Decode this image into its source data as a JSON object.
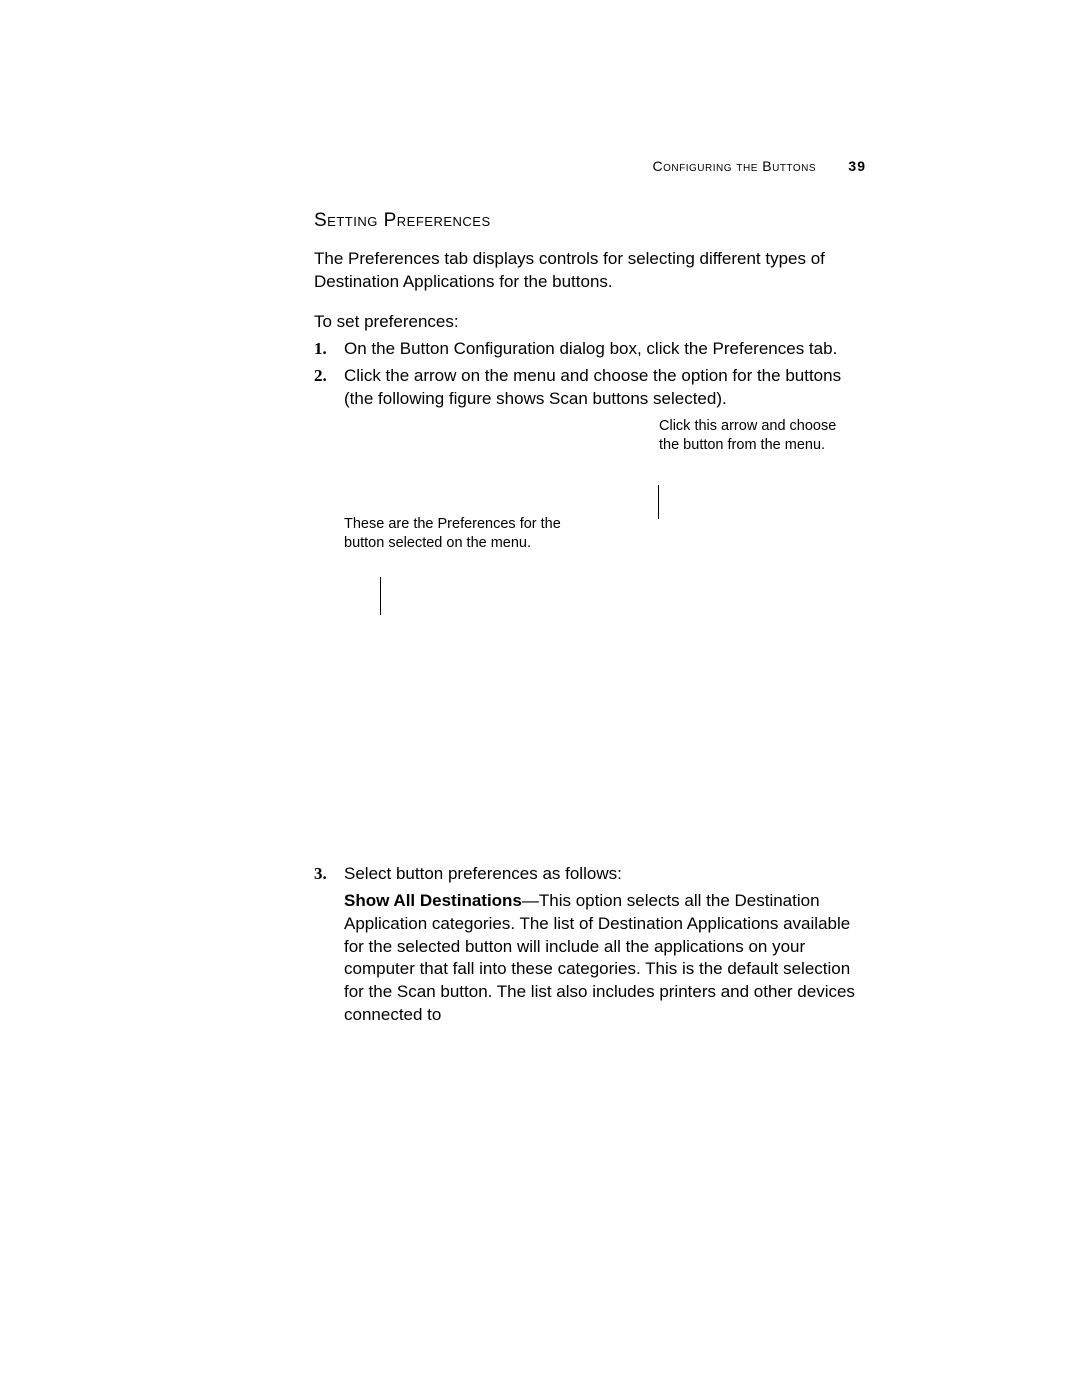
{
  "running_head": {
    "label": "Configuring the Buttons",
    "page": "39"
  },
  "heading": "Setting Preferences",
  "intro": "The Preferences tab displays controls for selecting different types of Destination Applications for the buttons.",
  "lead": "To set preferences:",
  "steps": {
    "s1": {
      "num": "1.",
      "text": "On the Button Configuration dialog box, click the Preferences tab."
    },
    "s2": {
      "num": "2.",
      "text": "Click the arrow on the menu and choose the option for the buttons (the following figure shows Scan buttons selected)."
    },
    "s3": {
      "num": "3.",
      "body_prefix": "Select button preferences as follows:",
      "bullet_label": "Show All Destinations",
      "bullet_rest": "—This option selects all the Destination Application categories. The list of Destination Applications available for the selected button will include all the applications on your computer that fall into these categories. This is the default selection for the Scan button. The list also includes printers and other devices connected to"
    }
  },
  "callouts": {
    "right": "Click this arrow and choose the button from the menu.",
    "left": "These are the Preferences for the button selected on the menu."
  }
}
